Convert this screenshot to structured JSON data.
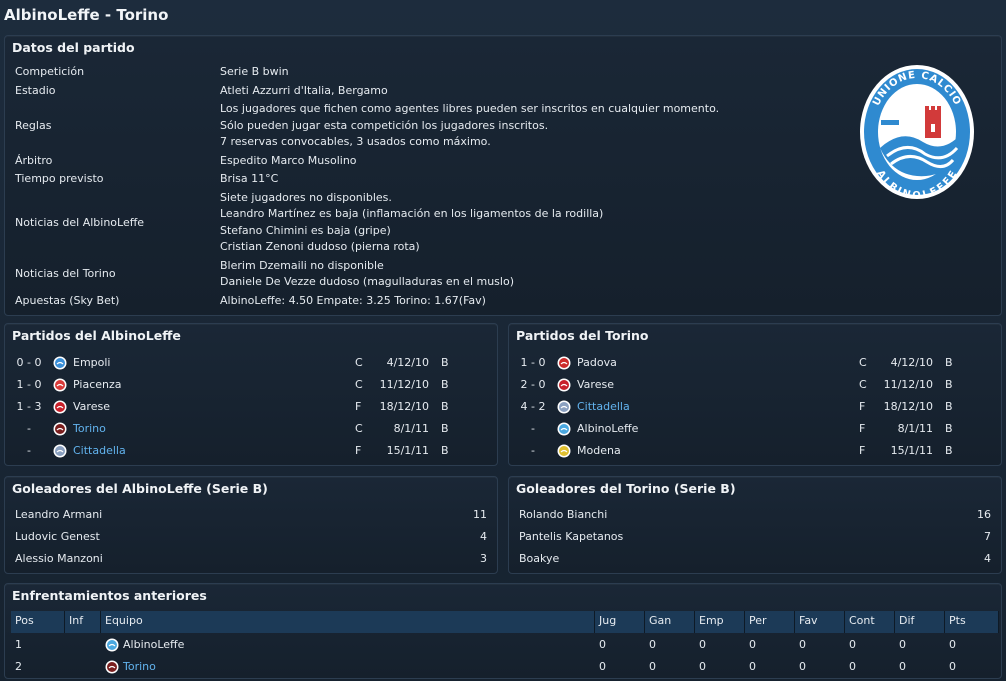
{
  "window": {
    "title": "AlbinoLeffe - Torino"
  },
  "match_details": {
    "title": "Datos del partido",
    "rows": [
      {
        "label": "Competición",
        "lines": [
          "Serie B bwin"
        ]
      },
      {
        "label": "Estadio",
        "lines": [
          "Atleti Azzurri d'Italia, Bergamo"
        ]
      },
      {
        "label": "Reglas",
        "lines": [
          "Los jugadores que fichen como agentes libres pueden ser inscritos en cualquier momento.",
          "Sólo pueden jugar esta competición los jugadores inscritos.",
          "7 reservas convocables, 3 usados como máximo."
        ]
      },
      {
        "label": "Árbitro",
        "lines": [
          "Espedito Marco Musolino"
        ]
      },
      {
        "label": "Tiempo previsto",
        "lines": [
          "Brisa 11°C"
        ]
      },
      {
        "label": "Noticias del AlbinoLeffe",
        "lines": [
          "Siete jugadores no disponibles.",
          "Leandro Martínez es baja (inflamación en los ligamentos de la rodilla)",
          "Stefano Chimini es baja (gripe)",
          "Cristian Zenoni dudoso (pierna rota)"
        ]
      },
      {
        "label": "Noticias del Torino",
        "lines": [
          "Blerim Dzemaili no disponible",
          "Daniele De Vezze dudoso (magulladuras en el muslo)"
        ]
      },
      {
        "label": "Apuestas (Sky Bet)",
        "lines": [
          "AlbinoLeffe: 4.50  Empate: 3.25  Torino: 1.67(Fav)"
        ]
      }
    ],
    "logo": {
      "text_top": "UNIONE CALCIO",
      "text_bottom": "ALBINOLEFFE"
    }
  },
  "home_fixtures": {
    "title": "Partidos del AlbinoLeffe",
    "rows": [
      {
        "score": "0 - 0",
        "team": "Empoli",
        "crest": "empoli-crest-icon",
        "crest_color": "#3a8fd8",
        "link": false,
        "venue": "C",
        "date": "4/12/10",
        "comp": "B"
      },
      {
        "score": "1 - 0",
        "team": "Piacenza",
        "crest": "piacenza-crest-icon",
        "crest_color": "#d83a3a",
        "link": false,
        "venue": "C",
        "date": "11/12/10",
        "comp": "B"
      },
      {
        "score": "1 - 3",
        "team": "Varese",
        "crest": "varese-crest-icon",
        "crest_color": "#c8202a",
        "link": false,
        "venue": "F",
        "date": "18/12/10",
        "comp": "B"
      },
      {
        "score": "-",
        "team": "Torino",
        "crest": "torino-crest-icon",
        "crest_color": "#7a1f1f",
        "link": true,
        "venue": "C",
        "date": "8/1/11",
        "comp": "B"
      },
      {
        "score": "-",
        "team": "Cittadella",
        "crest": "cittadella-crest-icon",
        "crest_color": "#8aa0c0",
        "link": true,
        "venue": "F",
        "date": "15/1/11",
        "comp": "B"
      }
    ]
  },
  "away_fixtures": {
    "title": "Partidos del Torino",
    "rows": [
      {
        "score": "1 - 0",
        "team": "Padova",
        "crest": "padova-crest-icon",
        "crest_color": "#cc2a2a",
        "link": false,
        "venue": "C",
        "date": "4/12/10",
        "comp": "B"
      },
      {
        "score": "2 - 0",
        "team": "Varese",
        "crest": "varese-crest-icon",
        "crest_color": "#c8202a",
        "link": false,
        "venue": "C",
        "date": "11/12/10",
        "comp": "B"
      },
      {
        "score": "4 - 2",
        "team": "Cittadella",
        "crest": "cittadella-crest-icon",
        "crest_color": "#8aa0c0",
        "link": true,
        "venue": "F",
        "date": "18/12/10",
        "comp": "B"
      },
      {
        "score": "-",
        "team": "AlbinoLeffe",
        "crest": "albinoleffe-crest-icon",
        "crest_color": "#4aa8e0",
        "link": false,
        "venue": "F",
        "date": "8/1/11",
        "comp": "B"
      },
      {
        "score": "-",
        "team": "Modena",
        "crest": "modena-crest-icon",
        "crest_color": "#e0c030",
        "link": false,
        "venue": "F",
        "date": "15/1/11",
        "comp": "B"
      }
    ]
  },
  "home_scorers": {
    "title": "Goleadores del AlbinoLeffe (Serie B)",
    "rows": [
      {
        "name": "Leandro Armani",
        "goals": "11"
      },
      {
        "name": "Ludovic Genest",
        "goals": "4"
      },
      {
        "name": "Alessio Manzoni",
        "goals": "3"
      }
    ]
  },
  "away_scorers": {
    "title": "Goleadores del Torino (Serie B)",
    "rows": [
      {
        "name": "Rolando Bianchi",
        "goals": "16"
      },
      {
        "name": "Pantelis Kapetanos",
        "goals": "7"
      },
      {
        "name": "Boakye",
        "goals": "4"
      }
    ]
  },
  "head_to_head": {
    "title": "Enfrentamientos anteriores",
    "columns": [
      "Pos",
      "Inf",
      "Equipo",
      "Jug",
      "Gan",
      "Emp",
      "Per",
      "Fav",
      "Cont",
      "Dif",
      "Pts"
    ],
    "rows": [
      {
        "pos": "1",
        "inf": "",
        "team": "AlbinoLeffe",
        "crest": "albinoleffe-crest-icon",
        "crest_color": "#4aa8e0",
        "link": false,
        "jug": "0",
        "gan": "0",
        "emp": "0",
        "per": "0",
        "fav": "0",
        "cont": "0",
        "dif": "0",
        "pts": "0"
      },
      {
        "pos": "2",
        "inf": "",
        "team": "Torino",
        "crest": "torino-crest-icon",
        "crest_color": "#7a1f1f",
        "link": true,
        "jug": "0",
        "gan": "0",
        "emp": "0",
        "per": "0",
        "fav": "0",
        "cont": "0",
        "dif": "0",
        "pts": "0"
      }
    ]
  },
  "colors": {
    "link": "#62b3ee",
    "header_bg": "#1c3a57",
    "panel_border": "#2c3d50",
    "logo_blue": "#2f8ad0"
  }
}
